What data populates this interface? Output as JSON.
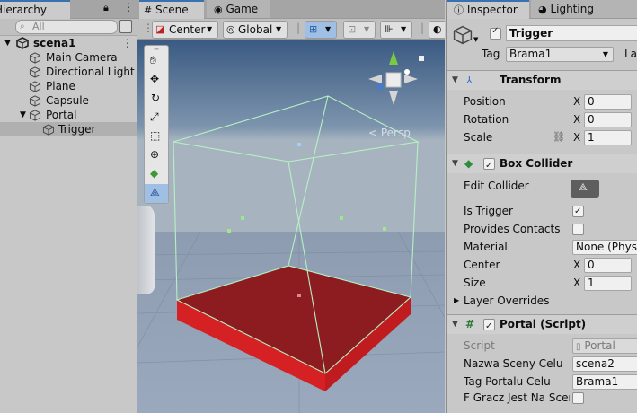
{
  "hierarchy": {
    "tab": "Hierarchy",
    "search_placeholder": "All",
    "scene_name": "scena1",
    "items": [
      {
        "label": "Main Camera"
      },
      {
        "label": "Directional Light"
      },
      {
        "label": "Plane"
      },
      {
        "label": "Capsule"
      },
      {
        "label": "Portal"
      },
      {
        "label": "Trigger"
      }
    ]
  },
  "scene": {
    "tabs": {
      "scene": "Scene",
      "game": "Game"
    },
    "toolbar": {
      "pivot": "Center",
      "space": "Global"
    },
    "gizmo_label": "< Persp"
  },
  "inspector": {
    "tabs": {
      "inspector": "Inspector",
      "lighting": "Lighting"
    },
    "object": {
      "name": "Trigger",
      "tag_label": "Tag",
      "tag_value": "Brama1",
      "layer_label": "La"
    },
    "transform": {
      "title": "Transform",
      "rows": [
        {
          "label": "Position",
          "axis": "X",
          "value": "0"
        },
        {
          "label": "Rotation",
          "axis": "X",
          "value": "0"
        },
        {
          "label": "Scale",
          "axis": "X",
          "value": "1"
        }
      ]
    },
    "box_collider": {
      "title": "Box Collider",
      "edit_collider": "Edit Collider",
      "is_trigger": "Is Trigger",
      "provides_contacts": "Provides Contacts",
      "material_label": "Material",
      "material_value": "None (Physic",
      "center_label": "Center",
      "center_axis": "X",
      "center_value": "0",
      "size_label": "Size",
      "size_axis": "X",
      "size_value": "1",
      "layer_overrides": "Layer Overrides"
    },
    "portal_script": {
      "title": "Portal (Script)",
      "script_label": "Script",
      "script_value": "Portal",
      "fields": [
        {
          "label": "Nazwa Sceny Celu",
          "value": "scena2"
        },
        {
          "label": "Tag Portalu Celu",
          "value": "Brama1"
        },
        {
          "label": "F Gracz Jest Na Scer",
          "value": ""
        }
      ]
    }
  }
}
